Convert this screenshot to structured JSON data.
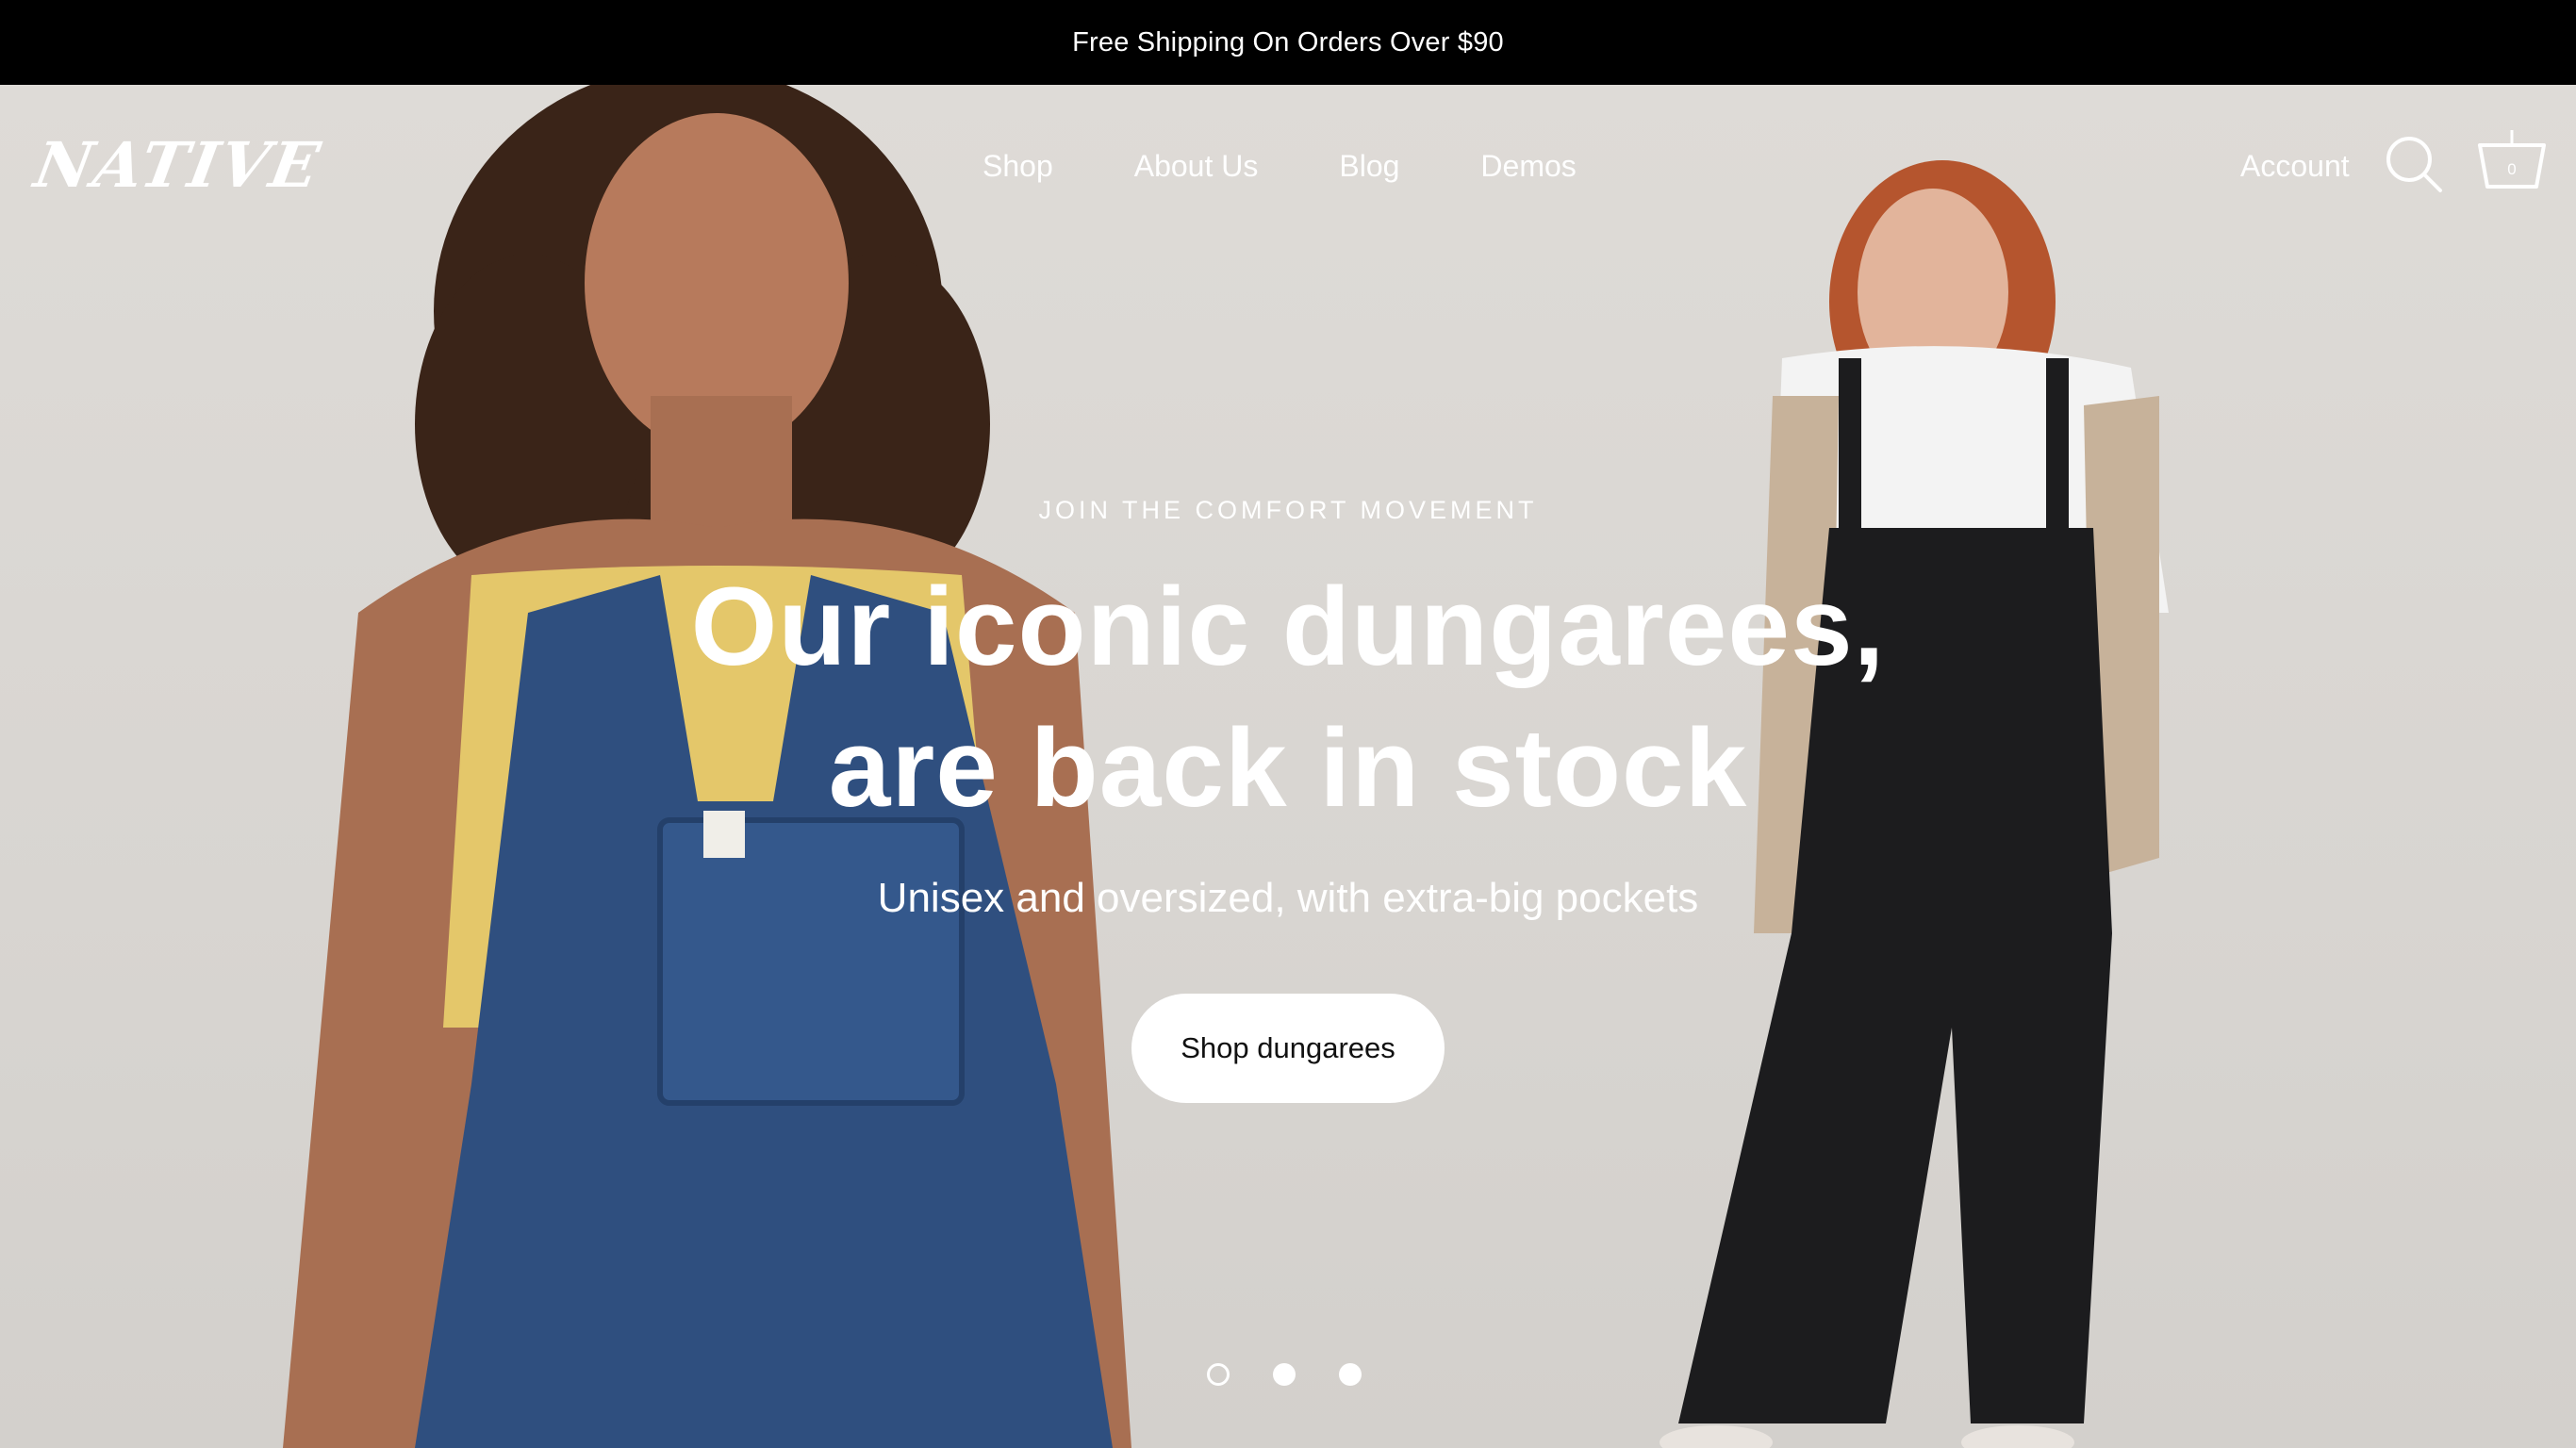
{
  "announcement": "Free Shipping On Orders Over $90",
  "header": {
    "logo": "NATIVE",
    "nav": [
      "Shop",
      "About Us",
      "Blog",
      "Demos"
    ],
    "account": "Account",
    "cart_count": "0"
  },
  "hero": {
    "eyebrow": "JOIN THE COMFORT MOVEMENT",
    "headline_line1": "Our iconic dungarees,",
    "headline_line2": "are back in stock",
    "subheading": "Unisex and oversized, with extra-big pockets",
    "cta": "Shop dungarees",
    "slides_total": 3,
    "slide_current": 1
  },
  "colors": {
    "announcement_bg": "#000000",
    "hero_bg": "#dbd8d4",
    "denim": "#2f4f7f",
    "black_dungarees": "#1c1c1e"
  }
}
